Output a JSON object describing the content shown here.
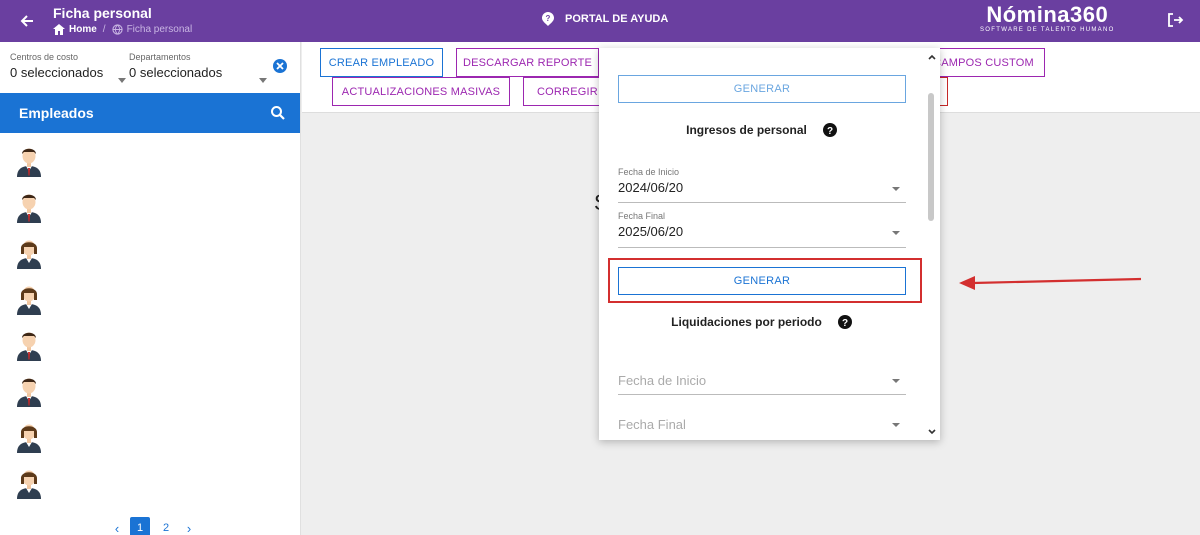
{
  "topbar": {
    "title": "Ficha personal",
    "breadcrumb_home": "Home",
    "breadcrumb_sep": "/",
    "breadcrumb_current": "Ficha personal",
    "help_portal": "PORTAL DE AYUDA",
    "logo_brand": "Nómina360",
    "logo_tagline": "SOFTWARE DE TALENTO HUMANO"
  },
  "sidebar": {
    "filter_cost_label": "Centros de costo",
    "filter_cost_value": "0 seleccionados",
    "filter_dept_label": "Departamentos",
    "filter_dept_value": "0 seleccionados",
    "employees_title": "Empleados",
    "employees": [
      {
        "gender": "male"
      },
      {
        "gender": "male"
      },
      {
        "gender": "female"
      },
      {
        "gender": "female"
      },
      {
        "gender": "male"
      },
      {
        "gender": "male"
      },
      {
        "gender": "female"
      },
      {
        "gender": "female"
      }
    ],
    "pagination": {
      "prev": "‹",
      "pages": [
        "1",
        "2"
      ],
      "next": "›",
      "current": "1"
    }
  },
  "toolbar": {
    "crear_empleado": "CREAR EMPLEADO",
    "descargar_reporte": "DESCARGAR REPORTE",
    "campos_custom": "CAMPOS CUSTOM",
    "actualizaciones_masivas": "ACTUALIZACIONES MASIVAS",
    "corregir": "CORREGIR T"
  },
  "main_partial_text": "S",
  "panel": {
    "generar_top": "GENERAR",
    "ingresos_title": "Ingresos de personal",
    "ingresos_fecha_inicio_label": "Fecha de Inicio",
    "ingresos_fecha_inicio_value": "2024/06/20",
    "ingresos_fecha_final_label": "Fecha Final",
    "ingresos_fecha_final_value": "2025/06/20",
    "generar_ingresos": "GENERAR",
    "liquidaciones_title": "Liquidaciones por periodo",
    "liq_fecha_inicio_placeholder": "Fecha de Inicio",
    "liq_fecha_final_placeholder": "Fecha Final"
  },
  "colors": {
    "topbar": "#6a3fa0",
    "primary_blue": "#1a73d4",
    "purple": "#9c27b0",
    "highlight_red": "#d32f2f"
  }
}
